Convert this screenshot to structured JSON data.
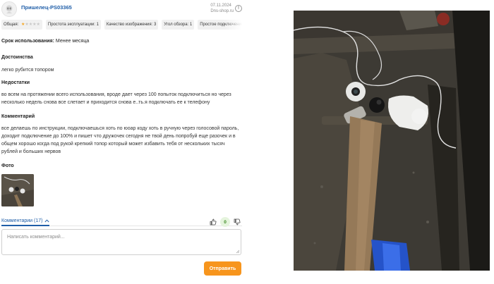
{
  "header": {
    "username": "Пришелец-PS03365",
    "date": "07.11.2024",
    "source": "Dns-shop.ru"
  },
  "tags": [
    {
      "label": "Общая:",
      "stars": 1
    },
    {
      "label": "Простота эксплуатации: 1"
    },
    {
      "label": "Качество изображения: 3"
    },
    {
      "label": "Угол обзора: 1"
    },
    {
      "label": "Простое подключение"
    }
  ],
  "rating_colors": {
    "on": "#f5a623",
    "off": "#c8c8c8"
  },
  "usage": {
    "label": "Срок использования:",
    "value": "Менее месяца"
  },
  "sections": {
    "pros_title": "Достоинства",
    "pros_text": "легко рубится топором",
    "cons_title": "Недостатки",
    "cons_text": "во всем на протяжении всего использования, вроде дает через 100 попыток подключиться но через несколько недель снова все слетает и приходится снова е..ть.я подключать ее к телефону",
    "comment_title": "Комментарий",
    "comment_text": "все делаешь по инструкции, подключаешься хоть по юоар коду хоть в ручную через голосовой пароль, доходит подключение до 100% и пишет что дружочек сегодня не твой день попробуй еще разочек и в общем хорошо когда под рукой крепкий топор который может избавить тебя от нескольких тысяч рублей и больших нервов",
    "photo_title": "Фото"
  },
  "comments": {
    "link_label": "Комментарии (17)",
    "votes": "0",
    "placeholder": "Написать комментарий...",
    "submit_label": "Отправить"
  },
  "icons": {
    "avatar": "alien-avatar-icon",
    "info": "info-icon",
    "chevron": "chevron-up-icon",
    "like": "thumb-up-icon",
    "dislike": "thumb-down-icon"
  },
  "colors": {
    "accent_link": "#1f5ea8",
    "submit_button": "#f7951d",
    "vote_badge_bg": "#e5f4dd",
    "vote_badge_text": "#3b8a22"
  }
}
